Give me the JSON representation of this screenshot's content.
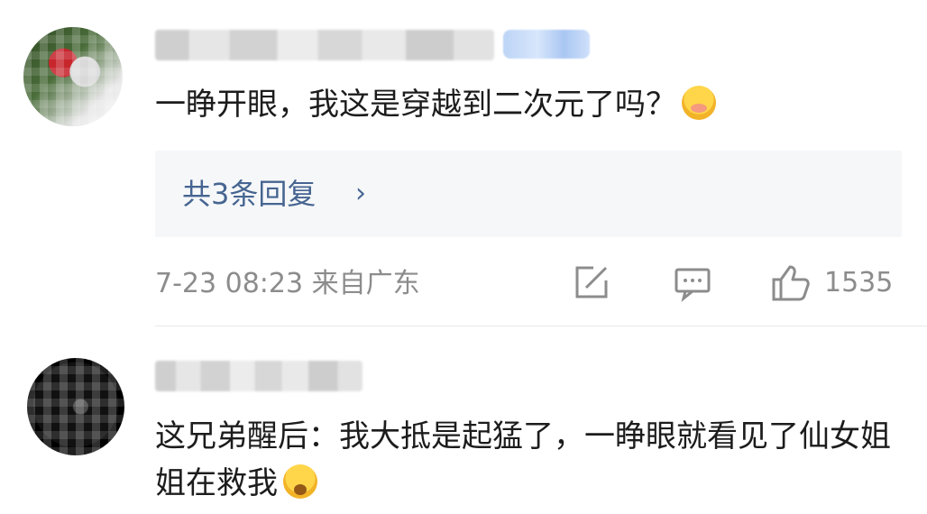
{
  "comments": [
    {
      "text": "一睁开眼，我这是穿越到二次元了吗？",
      "replies_label": "共3条回复",
      "replies_chevron": "›",
      "meta": "7-23 08:23 来自广东",
      "like_count": "1535",
      "icons": [
        "share-icon",
        "comment-icon",
        "thumbs-up-icon"
      ]
    },
    {
      "text": "这兄弟醒后：我大抵是起猛了，一睁眼就看见了仙女姐姐在救我"
    }
  ],
  "colors": {
    "link": "#466591",
    "meta": "#8c8c8c",
    "reply_bg": "#f6f7f9"
  }
}
